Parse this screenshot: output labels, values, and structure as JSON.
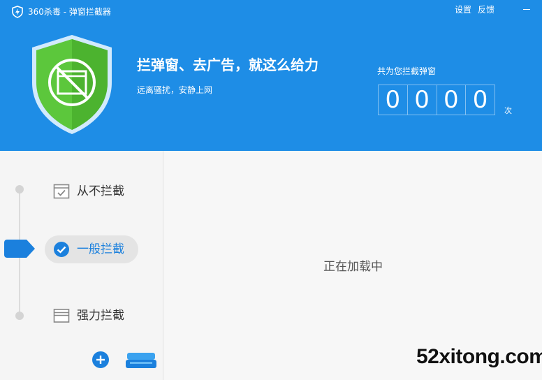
{
  "window": {
    "title": "360杀毒 - 弹窗拦截器",
    "settings_label": "设置",
    "feedback_label": "反馈",
    "icons": {
      "app": "lightning-shield-icon",
      "minimize": "minimize-icon"
    }
  },
  "banner": {
    "slogan": "拦弹窗、去广告，就这么给力",
    "subslogan": "远离骚扰，安静上网",
    "shield_icon": "shield-blocked-window-icon",
    "colors": {
      "background": "#1e8de6",
      "shield": "#5cc73c"
    }
  },
  "counter": {
    "label": "共为您拦截弹窗",
    "digits": [
      "0",
      "0",
      "0",
      "0"
    ],
    "unit": "次"
  },
  "modes": {
    "selected": "normal",
    "items": [
      {
        "key": "never",
        "label": "从不拦截",
        "icon": "window-check-icon"
      },
      {
        "key": "normal",
        "label": "一般拦截",
        "icon": "check-circle-icon"
      },
      {
        "key": "strong",
        "label": "强力拦截",
        "icon": "window-stack-icon"
      }
    ]
  },
  "bottom_actions": {
    "add_icon": "plus-circle-icon",
    "tray_icon": "tray-icon"
  },
  "content": {
    "status_text": "正在加载中"
  },
  "watermark": {
    "text": "52xitong.com"
  },
  "colors": {
    "accent": "#1b80dd",
    "header": "#1e8de6",
    "success": "#5cc73c"
  }
}
